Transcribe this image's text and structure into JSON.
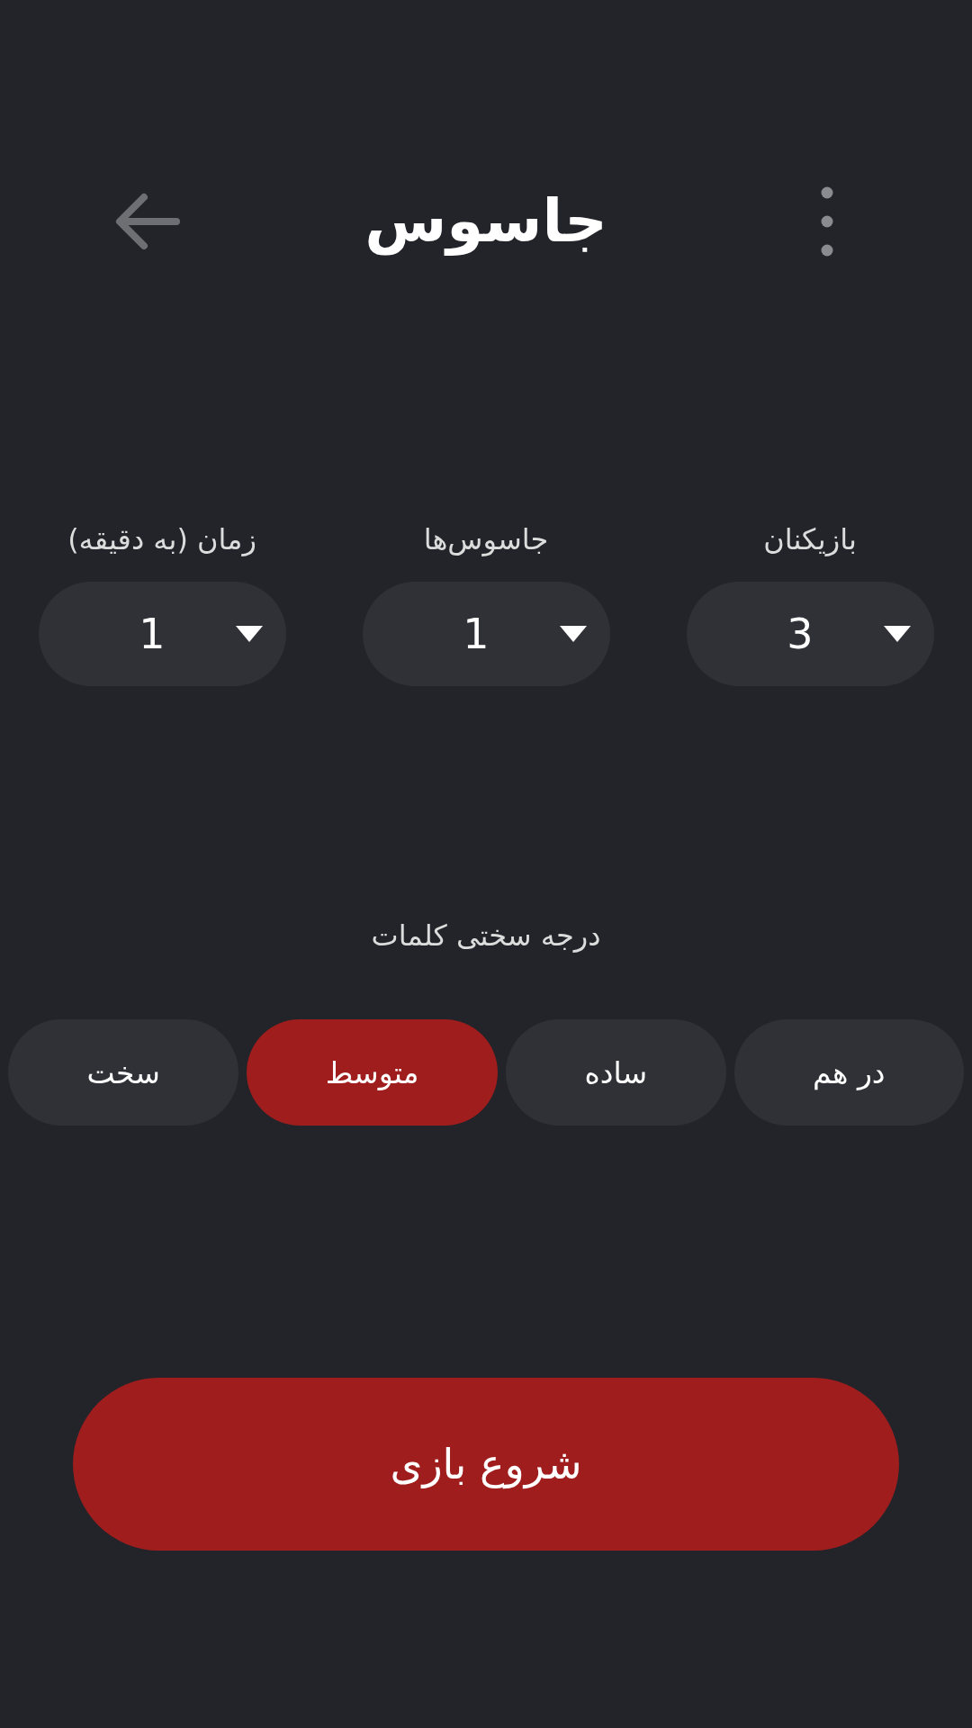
{
  "header": {
    "title": "جاسوس"
  },
  "settings": [
    {
      "label": "بازیکنان",
      "value": "3"
    },
    {
      "label": "جاسوس‌ها",
      "value": "1"
    },
    {
      "label": "زمان (به دقیقه)",
      "value": "1"
    }
  ],
  "difficulty": {
    "label": "درجه سختی کلمات",
    "options": [
      {
        "label": "در هم",
        "selected": false
      },
      {
        "label": "ساده",
        "selected": false
      },
      {
        "label": "متوسط",
        "selected": true
      },
      {
        "label": "سخت",
        "selected": false
      }
    ]
  },
  "start_button": {
    "label": "شروع بازی"
  }
}
